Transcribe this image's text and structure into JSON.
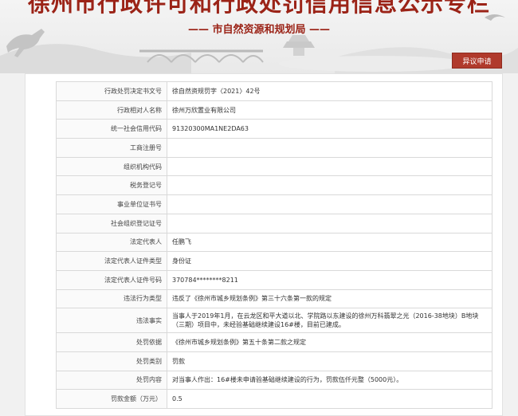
{
  "header": {
    "title": "徐州市行政许可和行政处罚信用信息公示专栏",
    "subtitle": "—— 市自然资源和规划局 ——",
    "objection_button": "异议申请"
  },
  "record": {
    "rows": [
      {
        "label": "行政处罚决定书文号",
        "value": "徐自然资规罚字〈2021〉42号"
      },
      {
        "label": "行政相对人名称",
        "value": "徐州万欣置业有限公司"
      },
      {
        "label": "统一社会信用代码",
        "value": "91320300MA1NE2DA63"
      },
      {
        "label": "工商注册号",
        "value": ""
      },
      {
        "label": "组织机构代码",
        "value": ""
      },
      {
        "label": "税务登记号",
        "value": ""
      },
      {
        "label": "事业单位证书号",
        "value": ""
      },
      {
        "label": "社会组织登记证号",
        "value": ""
      },
      {
        "label": "法定代表人",
        "value": "任鹏飞"
      },
      {
        "label": "法定代表人证件类型",
        "value": "身份证"
      },
      {
        "label": "法定代表人证件号码",
        "value": "370784********8211"
      },
      {
        "label": "违法行为类型",
        "value": "违反了《徐州市城乡规划条例》第三十六条第一款的规定"
      },
      {
        "label": "违法事实",
        "value": "当事人于2019年1月，在云龙区和平大道以北、学院路以东建设的徐州万科翡翠之光（2016-38地块）B地块（三期）项目中，未经验基础继续建设16#楼，目前已建成。"
      },
      {
        "label": "处罚依据",
        "value": "《徐州市城乡规划条例》第五十条第二款之规定"
      },
      {
        "label": "处罚类别",
        "value": "罚款"
      },
      {
        "label": "处罚内容",
        "value": "对当事人作出：16#楼未申请验基础继续建设的行为，罚款伍仟元整（5000元）。"
      },
      {
        "label": "罚款金额（万元）",
        "value": "0.5"
      }
    ]
  }
}
